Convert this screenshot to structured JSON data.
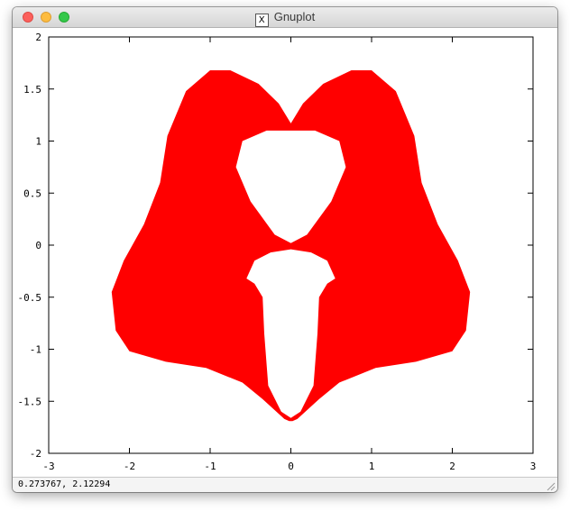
{
  "window": {
    "title": "Gnuplot",
    "x_icon": "X",
    "buttons": [
      "close",
      "minimize",
      "zoom"
    ]
  },
  "statusbar": {
    "coordinates": "0.273767,  2.12294"
  },
  "chart_data": {
    "type": "area",
    "description_of_shape": "filled region symmetric about x=0 with two inner holes",
    "fill_color": "#ff0000",
    "xlim": [
      -3,
      3
    ],
    "ylim": [
      -2,
      2
    ],
    "x_ticks": [
      "-3",
      "-2",
      "-1",
      "0",
      "1",
      "2",
      "3"
    ],
    "y_ticks": [
      "2",
      "1.5",
      "1",
      "0.5",
      "0",
      "-0.5",
      "-1",
      "-1.5",
      "-2"
    ],
    "outer_boundary_right_half": [
      [
        0,
        1.17
      ],
      [
        0.15,
        1.36
      ],
      [
        0.4,
        1.55
      ],
      [
        0.75,
        1.68
      ],
      [
        1.0,
        1.68
      ],
      [
        1.3,
        1.48
      ],
      [
        1.53,
        1.05
      ],
      [
        1.62,
        0.6
      ],
      [
        1.82,
        0.2
      ],
      [
        2.07,
        -0.15
      ],
      [
        2.22,
        -0.45
      ],
      [
        2.17,
        -0.82
      ],
      [
        2.0,
        -1.02
      ],
      [
        1.55,
        -1.12
      ],
      [
        1.05,
        -1.18
      ],
      [
        0.6,
        -1.32
      ],
      [
        0.35,
        -1.48
      ],
      [
        0.08,
        -1.67
      ],
      [
        0.02,
        -1.69
      ]
    ],
    "upper_hole_right_half": [
      [
        0,
        1.1
      ],
      [
        0.3,
        1.1
      ],
      [
        0.6,
        1.0
      ],
      [
        0.68,
        0.75
      ],
      [
        0.5,
        0.42
      ],
      [
        0.2,
        0.1
      ],
      [
        0,
        0.02
      ]
    ],
    "lower_hole_right_half": [
      [
        0,
        -0.04
      ],
      [
        0.25,
        -0.07
      ],
      [
        0.45,
        -0.15
      ],
      [
        0.55,
        -0.32
      ],
      [
        0.45,
        -0.37
      ],
      [
        0.35,
        -0.5
      ],
      [
        0.33,
        -0.85
      ],
      [
        0.28,
        -1.35
      ],
      [
        0.12,
        -1.6
      ],
      [
        0,
        -1.66
      ]
    ]
  }
}
